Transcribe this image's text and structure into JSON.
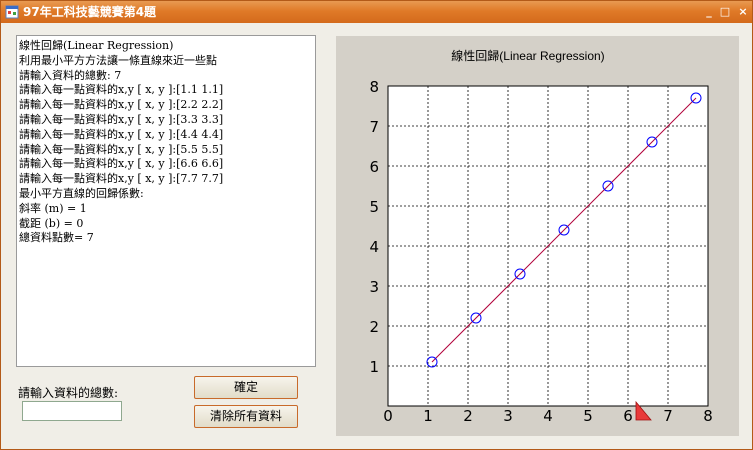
{
  "window": {
    "title": "97年工科技藝競賽第4題",
    "minimize_glyph": "_",
    "maximize_glyph": "□",
    "close_glyph": "×",
    "icon": "app-window-icon"
  },
  "output_lines": [
    "線性回歸(Linear Regression)",
    "利用最小平方方法讓一條直線來近一些點",
    "請輸入資料的總數: 7",
    "請輸入每一點資料的x,y [ x, y ]:[1.1 1.1]",
    "請輸入每一點資料的x,y [ x, y ]:[2.2 2.2]",
    "請輸入每一點資料的x,y [ x, y ]:[3.3 3.3]",
    "請輸入每一點資料的x,y [ x, y ]:[4.4 4.4]",
    "請輸入每一點資料的x,y [ x, y ]:[5.5 5.5]",
    "請輸入每一點資料的x,y [ x, y ]:[6.6 6.6]",
    "請輸入每一點資料的x,y [ x, y ]:[7.7 7.7]",
    "最小平方直線的回歸係數:",
    "斜率 (m)  =  1",
    "截距 (b)  =  0",
    "總資料點數=  7"
  ],
  "form": {
    "count_label": "請輸入資料的總數:",
    "count_value": "",
    "ok_button": "確定",
    "clear_button": "清除所有資料"
  },
  "colors": {
    "point_stroke": "#0000ff",
    "line": "#b0003a",
    "cursor": "#e83a3a",
    "titlebar": "#e07a28"
  },
  "chart_data": {
    "type": "scatter",
    "title": "線性回歸(Linear Regression)",
    "xlabel": "",
    "ylabel": "",
    "xlim": [
      0,
      8
    ],
    "ylim": [
      0,
      8
    ],
    "xticks": [
      "0",
      "1",
      "2",
      "3",
      "4",
      "5",
      "6",
      "7",
      "8"
    ],
    "yticks": [
      "1",
      "2",
      "3",
      "4",
      "5",
      "6",
      "7",
      "8"
    ],
    "grid": true,
    "points": [
      {
        "x": 1.1,
        "y": 1.1
      },
      {
        "x": 2.2,
        "y": 2.2
      },
      {
        "x": 3.3,
        "y": 3.3
      },
      {
        "x": 4.4,
        "y": 4.4
      },
      {
        "x": 5.5,
        "y": 5.5
      },
      {
        "x": 6.6,
        "y": 6.6
      },
      {
        "x": 7.7,
        "y": 7.7
      }
    ],
    "regression": {
      "m": 1,
      "b": 0
    }
  }
}
